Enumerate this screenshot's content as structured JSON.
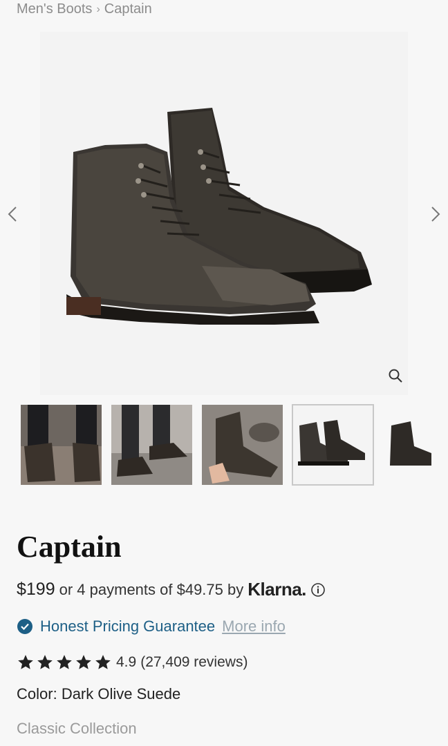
{
  "breadcrumb": {
    "parent": "Men's Boots",
    "separator": "›",
    "current": "Captain"
  },
  "product": {
    "title": "Captain",
    "price": "$199",
    "installments_text": "or 4 payments of $49.75 by",
    "installments_provider": "Klarna.",
    "guarantee_label": "Honest Pricing Guarantee",
    "guarantee_link": "More info",
    "rating_value": "4.9",
    "review_count": "(27,409 reviews)",
    "rating_stars": 5,
    "color_label": "Color:",
    "color_value": "Dark Olive Suede",
    "collection": "Classic Collection"
  },
  "gallery": {
    "selected_index": 3,
    "thumbnails": [
      "thumb-lifestyle-front",
      "thumb-lifestyle-side",
      "thumb-hand-held",
      "thumb-pair-product",
      "thumb-single-product"
    ]
  },
  "icons": {
    "prev": "chevron-left-icon",
    "next": "chevron-right-icon",
    "zoom": "search-icon",
    "info": "info-icon",
    "check": "check-badge-icon",
    "star": "star-icon"
  },
  "colors": {
    "accent": "#1d5f86",
    "link": "#9aa7b0",
    "boot": "#3a3632"
  }
}
